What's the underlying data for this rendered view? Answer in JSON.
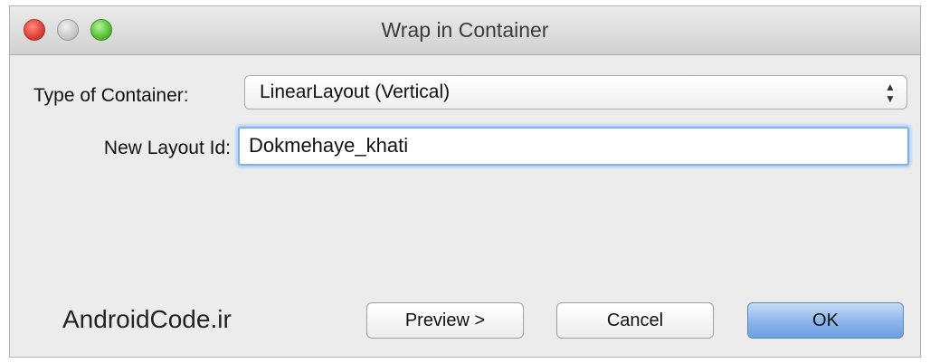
{
  "window": {
    "title": "Wrap in Container",
    "controls": [
      "close",
      "minimize",
      "zoom"
    ]
  },
  "form": {
    "type_label": "Type of Container:",
    "type_value": "LinearLayout (Vertical)",
    "id_label": "New Layout Id:",
    "id_value": "Dokmehaye_khati"
  },
  "watermark": "AndroidCode.ir",
  "buttons": {
    "preview": "Preview >",
    "cancel": "Cancel",
    "ok": "OK"
  },
  "colors": {
    "focus_ring": "#7fb2e8",
    "default_button": "#8ab4ea",
    "close": "#e0443e",
    "zoom": "#5cc43c"
  },
  "icons": {
    "select_arrows": "up-down-arrows-icon"
  }
}
